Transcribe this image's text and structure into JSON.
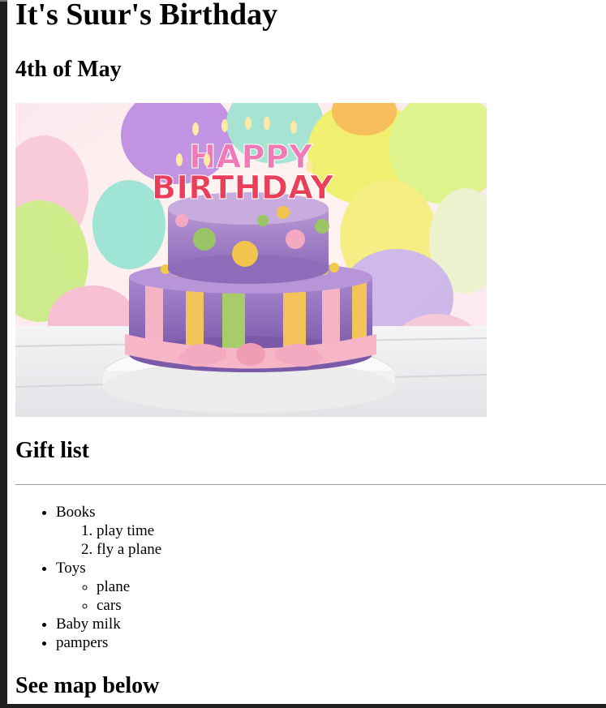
{
  "page": {
    "title": "It's Suur's Birthday",
    "date": "4th of May",
    "gift_heading": "Gift list",
    "map_heading": "See map below"
  },
  "image": {
    "icon": "birthday-cake-image",
    "cake_text_top": "HAPPY",
    "cake_text_bottom": "BIRTHDAY"
  },
  "gifts": [
    {
      "label": "Books",
      "sub": [
        "play time",
        "fly a plane"
      ],
      "sub_type": "ordered"
    },
    {
      "label": "Toys",
      "sub": [
        "plane",
        "cars"
      ],
      "sub_type": "unordered"
    },
    {
      "label": "Baby milk"
    },
    {
      "label": "pampers"
    }
  ],
  "colors": {
    "frame": "#1f1f1f",
    "divider": "#9b9b9b"
  }
}
